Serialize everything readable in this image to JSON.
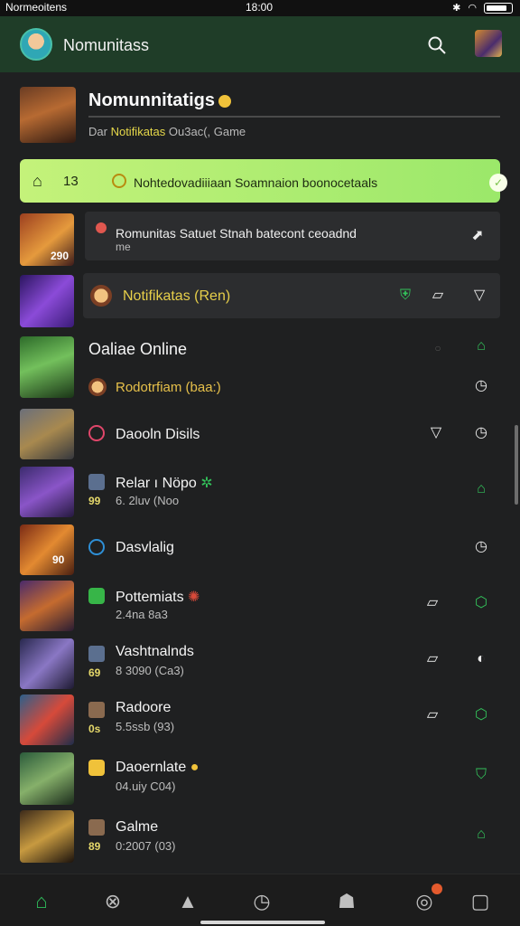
{
  "status_bar": {
    "carrier": "Normeoitens",
    "time": "18:00"
  },
  "app_bar": {
    "title": "Nomunitass"
  },
  "featured": {
    "title": "Nomunnitatigs",
    "subtitle_prefix": "Dar",
    "subtitle_highlight": "Notifikatas",
    "subtitle_rest": "Ou3ac(, Game"
  },
  "banner": {
    "count": "13",
    "text": "Nohtedovadiiiaan Soamnaion boonocetaals"
  },
  "message": {
    "line1": "Romunitas Satuet Stnah batecont ceoadnd",
    "line2": "me"
  },
  "notif_row": {
    "label": "Notifikatas",
    "tag": "(Ren)"
  },
  "online_row": {
    "title": "Oaliae Online",
    "sub_label": "Rodotrfiam",
    "sub_tag": "(baa:)"
  },
  "dropdown_row": {
    "label": "Daooln Disils"
  },
  "thumb_badges": {
    "row1": "290",
    "row4": "90"
  },
  "items": [
    {
      "name": "Relar ı Nöpo",
      "sub": "6. 2luv (Noo",
      "badge": "99"
    },
    {
      "name": "Dasvlalig",
      "sub": ""
    },
    {
      "name": "Pottemiats",
      "sub": "2.4na 8a3"
    },
    {
      "name": "Vashtnalnds",
      "sub": "8 3090 (Ca3)",
      "badge": "69"
    },
    {
      "name": "Radoore",
      "sub": "5.5ssb (93)",
      "badge": "0s"
    },
    {
      "name": "Daoernlate",
      "sub": "04.uiy C04)"
    },
    {
      "name": "Galme",
      "sub": "0:2007 (03)",
      "badge": "89"
    }
  ],
  "colors": {
    "accent_green": "#33c15a",
    "header_bg": "#1f3d28",
    "banner_green": "#b7ef74"
  },
  "icons": [
    "search-icon",
    "profile-avatar",
    "home-icon",
    "check-icon",
    "arrow-icon",
    "clock-icon",
    "funnel-icon",
    "shield-icon",
    "bell-icon"
  ]
}
